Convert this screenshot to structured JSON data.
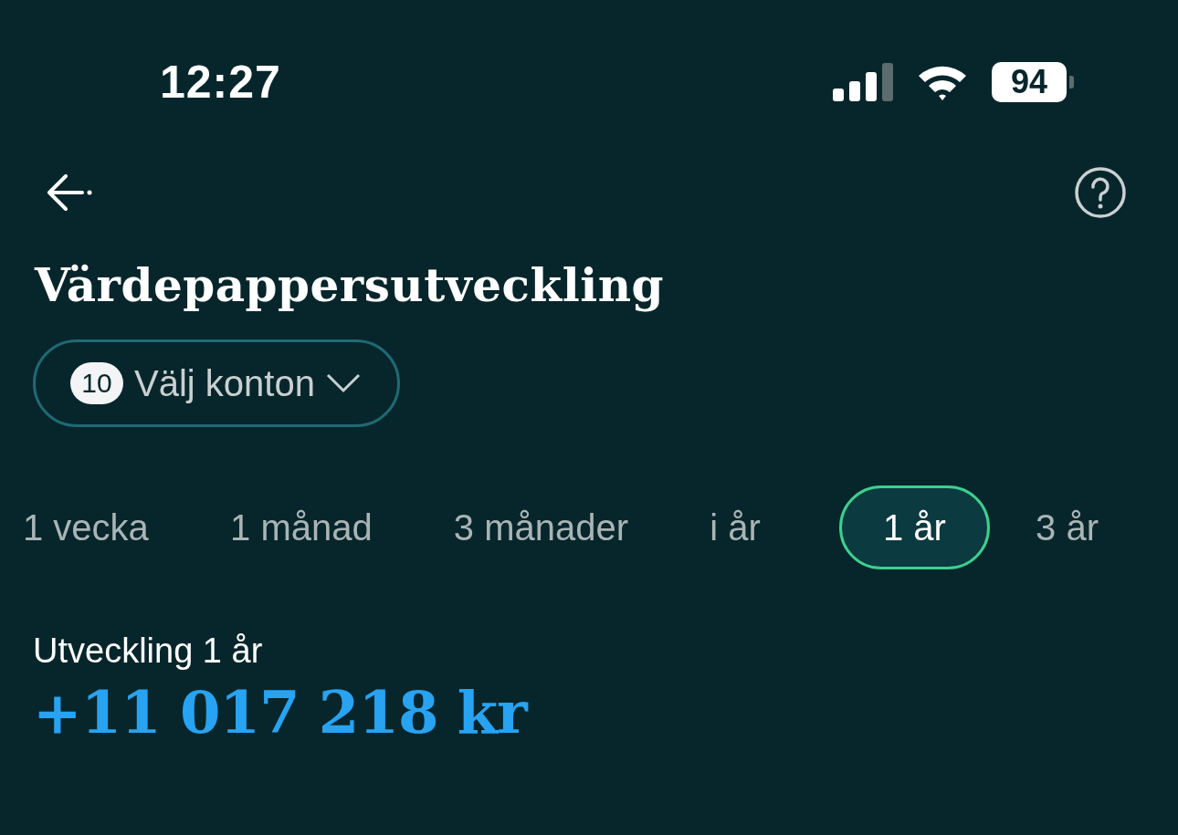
{
  "status_bar": {
    "time": "12:27",
    "battery": "94"
  },
  "title": "Värdepappersutveckling",
  "account_selector": {
    "count": "10",
    "label": "Välj konton"
  },
  "periods": [
    {
      "label": "1 vecka",
      "selected": false
    },
    {
      "label": "1 månad",
      "selected": false
    },
    {
      "label": "3 månader",
      "selected": false
    },
    {
      "label": "i år",
      "selected": false
    },
    {
      "label": "1 år",
      "selected": true
    },
    {
      "label": "3 år",
      "selected": false
    }
  ],
  "summary": {
    "label": "Utveckling 1 år",
    "value": "+11 017 218 kr"
  }
}
